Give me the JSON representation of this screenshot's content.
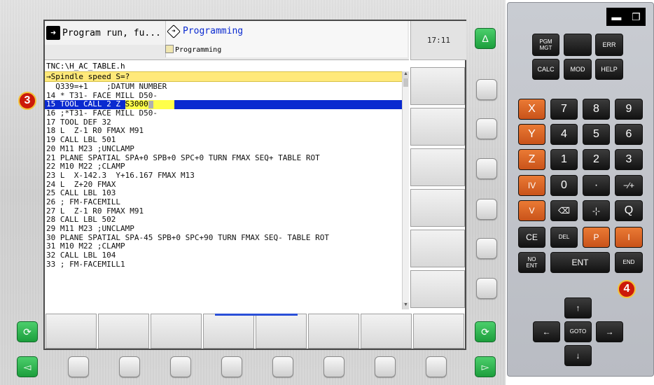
{
  "header": {
    "tab_program_run": "Program run, fu...",
    "tab_programming": "Programming",
    "tab_programming_sub": "Programming",
    "clock": "17:11"
  },
  "program": {
    "file_path": "TNC:\\H_AC_TABLE.h",
    "prompt": "→Spindle speed  S=?",
    "lines": [
      "  Q339=+1    ;DATUM NUMBER",
      "14 * T31- FACE MILL D50-",
      "15 TOOL CALL 2 Z ",
      "16 ;*T31- FACE MILL D50-",
      "17 TOOL DEF 32",
      "18 L  Z-1 R0 FMAX M91",
      "19 CALL LBL 501",
      "20 M11 M23 ;UNCLAMP",
      "21 PLANE SPATIAL SPA+0 SPB+0 SPC+0 TURN FMAX SEQ+ TABLE ROT",
      "22 M10 M22 ;CLAMP",
      "23 L  X-142.3  Y+16.167 FMAX M13",
      "24 L  Z+20 FMAX",
      "25 CALL LBL 103",
      "26 ; FM-FACEMILL",
      "27 L  Z-1 R0 FMAX M91",
      "28 CALL LBL 502",
      "29 M11 M23 ;UNCLAMP",
      "30 PLANE SPATIAL SPA-45 SPB+0 SPC+90 TURN FMAX SEQ- TABLE ROT",
      "31 M10 M22 ;CLAMP",
      "32 CALL LBL 104",
      "33 ; FM-FACEMILL1"
    ],
    "selected_edit_value": "S3000"
  },
  "badges": {
    "left": "3",
    "right": "4"
  },
  "keypad": {
    "pgm_mgt": "PGM MGT",
    "err": "ERR",
    "calc": "CALC",
    "mod": "MOD",
    "help": "HELP",
    "x": "X",
    "y": "Y",
    "z": "Z",
    "iv": "IV",
    "v": "V",
    "n7": "7",
    "n8": "8",
    "n9": "9",
    "n4": "4",
    "n5": "5",
    "n6": "6",
    "n1": "1",
    "n2": "2",
    "n3": "3",
    "n0": "0",
    "dot": "·",
    "sign": "−∕+",
    "backspace": "⌫",
    "actual_pos": "-¦-",
    "q": "Q",
    "ce": "CE",
    "del": "DEL",
    "p": "P",
    "i": "I",
    "no_ent": "NO ENT",
    "ent": "ENT",
    "end": "END",
    "goto": "GOTO",
    "arrow_up": "↑",
    "arrow_down": "↓",
    "arrow_left": "←",
    "arrow_right": "→"
  },
  "green_buttons": {
    "delta": "Δ",
    "refresh_left": "⟳",
    "refresh_right": "⟳",
    "prev": "◅",
    "next": "▻"
  },
  "window_controls": {
    "minimize": "▬",
    "restore": "❐"
  },
  "colors": {
    "selected_line": "#0a2ad0",
    "prompt_line": "#ffe97a",
    "edit_field": "#ffff4a",
    "orange_key": "#d9622a",
    "green_button": "#2cb64c",
    "badge": "#cc1a0a"
  }
}
